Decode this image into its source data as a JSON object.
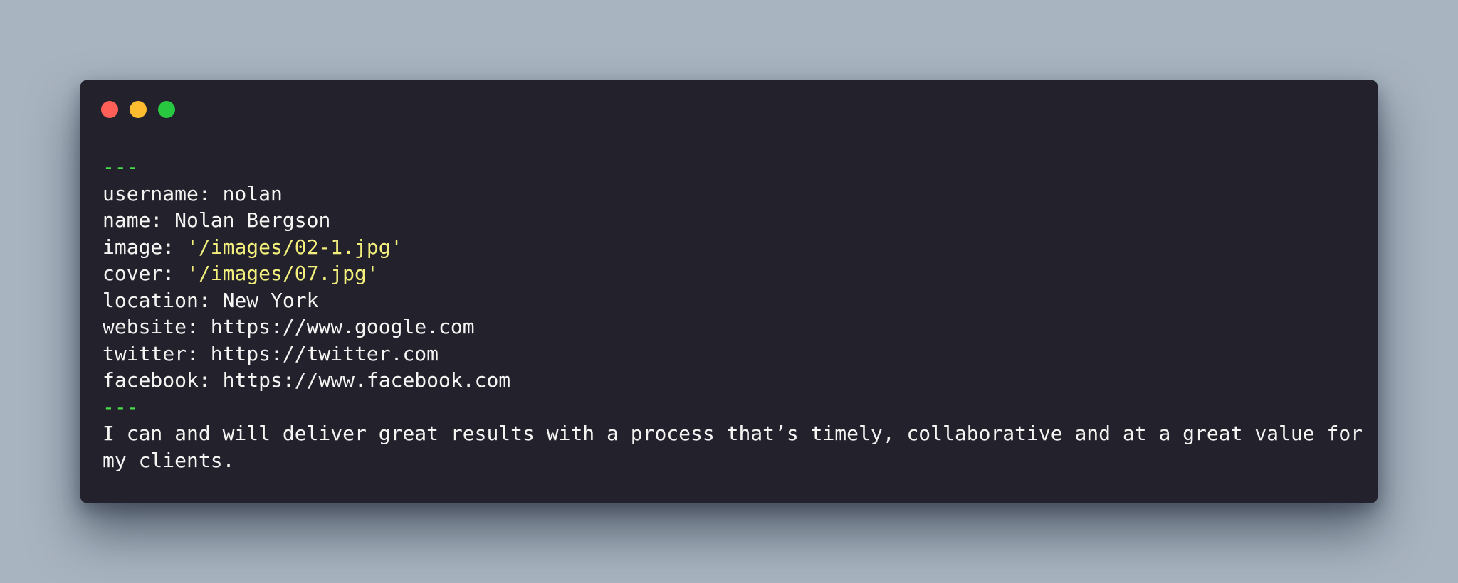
{
  "window": {
    "controls": {
      "close": {
        "color": "#ff5f57"
      },
      "minimize": {
        "color": "#febc2e"
      },
      "maximize": {
        "color": "#28c840"
      }
    }
  },
  "colors": {
    "background": "#a8b4c0",
    "window": "#22212c",
    "text": "#f4f4f2",
    "delimiter": "#4ade4a",
    "string": "#f3ef7d"
  },
  "code": {
    "delimiter_open": "---",
    "fields": [
      {
        "key": "username: ",
        "value": "nolan",
        "is_string": false
      },
      {
        "key": "name: ",
        "value": "Nolan Bergson",
        "is_string": false
      },
      {
        "key": "image: ",
        "value": "'/images/02-1.jpg'",
        "is_string": true
      },
      {
        "key": "cover: ",
        "value": "'/images/07.jpg'",
        "is_string": true
      },
      {
        "key": "location: ",
        "value": "New York",
        "is_string": false
      },
      {
        "key": "website: ",
        "value": "https://www.google.com",
        "is_string": false
      },
      {
        "key": "twitter: ",
        "value": "https://twitter.com",
        "is_string": false
      },
      {
        "key": "facebook: ",
        "value": "https://www.facebook.com",
        "is_string": false
      }
    ],
    "delimiter_close": "---",
    "body": "I can and will deliver great results with a process that’s timely, collaborative and at a great value for my clients."
  }
}
